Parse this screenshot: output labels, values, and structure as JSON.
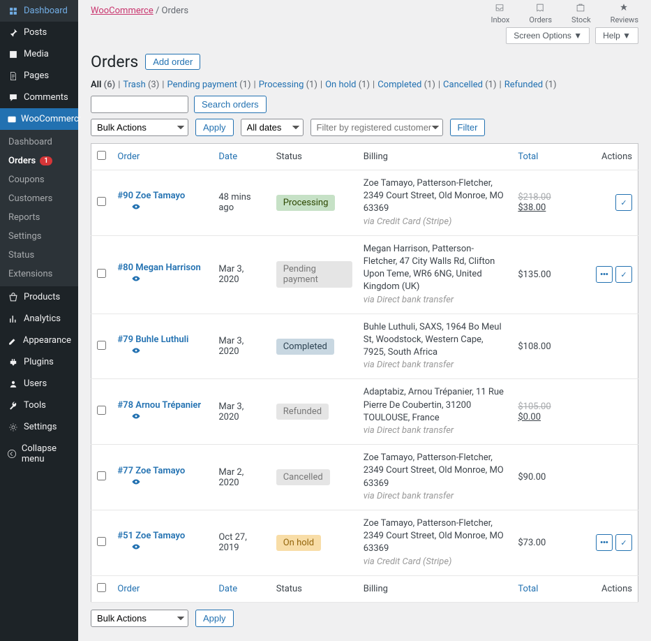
{
  "sidebar": {
    "items": [
      {
        "label": "Dashboard",
        "icon": "dashboard"
      },
      {
        "label": "Posts",
        "icon": "pin"
      },
      {
        "label": "Media",
        "icon": "media"
      },
      {
        "label": "Pages",
        "icon": "page"
      },
      {
        "label": "Comments",
        "icon": "comment"
      }
    ],
    "woo": {
      "label": "WooCommerce",
      "icon": "woo"
    },
    "woo_sub": [
      {
        "label": "Dashboard"
      },
      {
        "label": "Orders",
        "current": true,
        "badge": "1"
      },
      {
        "label": "Coupons"
      },
      {
        "label": "Customers"
      },
      {
        "label": "Reports"
      },
      {
        "label": "Settings"
      },
      {
        "label": "Status"
      },
      {
        "label": "Extensions"
      }
    ],
    "after": [
      {
        "label": "Products",
        "icon": "products"
      },
      {
        "label": "Analytics",
        "icon": "analytics"
      },
      {
        "label": "Appearance",
        "icon": "appearance"
      },
      {
        "label": "Plugins",
        "icon": "plugins"
      },
      {
        "label": "Users",
        "icon": "users"
      },
      {
        "label": "Tools",
        "icon": "tools"
      },
      {
        "label": "Settings",
        "icon": "settings"
      },
      {
        "label": "Collapse menu",
        "icon": "collapse"
      }
    ]
  },
  "breadcrumb": {
    "woo": "WooCommerce",
    "current": "Orders"
  },
  "topbar": [
    {
      "label": "Inbox"
    },
    {
      "label": "Orders"
    },
    {
      "label": "Stock"
    },
    {
      "label": "Reviews"
    }
  ],
  "screen_options": "Screen Options ▼",
  "help": "Help ▼",
  "page_title": "Orders",
  "add_order": "Add order",
  "views": [
    {
      "label": "All",
      "count": "(6)",
      "current": true
    },
    {
      "label": "Trash",
      "count": "(3)"
    },
    {
      "label": "Pending payment",
      "count": "(1)"
    },
    {
      "label": "Processing",
      "count": "(1)"
    },
    {
      "label": "On hold",
      "count": "(1)"
    },
    {
      "label": "Completed",
      "count": "(1)"
    },
    {
      "label": "Cancelled",
      "count": "(1)"
    },
    {
      "label": "Refunded",
      "count": "(1)"
    }
  ],
  "search_btn": "Search orders",
  "bulk_actions": "Bulk Actions",
  "apply": "Apply",
  "all_dates": "All dates",
  "filter_placeholder": "Filter by registered customer",
  "filter": "Filter",
  "cols": {
    "order": "Order",
    "date": "Date",
    "status": "Status",
    "billing": "Billing",
    "total": "Total",
    "actions": "Actions"
  },
  "rows": [
    {
      "id": "#90 Zoe Tamayo",
      "date": "48 mins ago",
      "status": "Processing",
      "status_class": "processing",
      "billing": "Zoe Tamayo, Patterson-Fletcher, 2349 Court Street, Old Monroe, MO 63369",
      "via": "via Credit Card (Stripe)",
      "total_strike": "$218.00",
      "total_ins": "$38.00",
      "actions": [
        "complete"
      ]
    },
    {
      "id": "#80 Megan Harrison",
      "date": "Mar 3, 2020",
      "status": "Pending payment",
      "status_class": "pending",
      "billing": "Megan Harrison, Patterson-Fletcher, 47 City Walls Rd, Clifton Upon Teme, WR6 6NG, United Kingdom (UK)",
      "via": "via Direct bank transfer",
      "total": "$135.00",
      "actions": [
        "more",
        "complete"
      ]
    },
    {
      "id": "#79 Buhle Luthuli",
      "date": "Mar 3, 2020",
      "status": "Completed",
      "status_class": "completed",
      "billing": "Buhle Luthuli, SAXS, 1964 Bo Meul St, Woodstock, Western Cape, 7925, South Africa",
      "via": "via Direct bank transfer",
      "total": "$108.00",
      "actions": []
    },
    {
      "id": "#78 Arnou Trépanier",
      "date": "Mar 3, 2020",
      "status": "Refunded",
      "status_class": "refunded",
      "billing": "Adaptabiz, Arnou Trépanier, 11 Rue Pierre De Coubertin, 31200 TOULOUSE, France",
      "via": "via Direct bank transfer",
      "total_strike": "$105.00",
      "total_ins": "$0.00",
      "actions": []
    },
    {
      "id": "#77 Zoe Tamayo",
      "date": "Mar 2, 2020",
      "status": "Cancelled",
      "status_class": "cancelled",
      "billing": "Zoe Tamayo, Patterson-Fletcher, 2349 Court Street, Old Monroe, MO 63369",
      "via": "via Direct bank transfer",
      "total": "$90.00",
      "actions": []
    },
    {
      "id": "#51 Zoe Tamayo",
      "date": "Oct 27, 2019",
      "status": "On hold",
      "status_class": "onhold",
      "billing": "Zoe Tamayo, Patterson-Fletcher, 2349 Court Street, Old Monroe, MO 63369",
      "via": "via Credit Card (Stripe)",
      "total": "$73.00",
      "actions": [
        "more",
        "complete"
      ]
    }
  ]
}
